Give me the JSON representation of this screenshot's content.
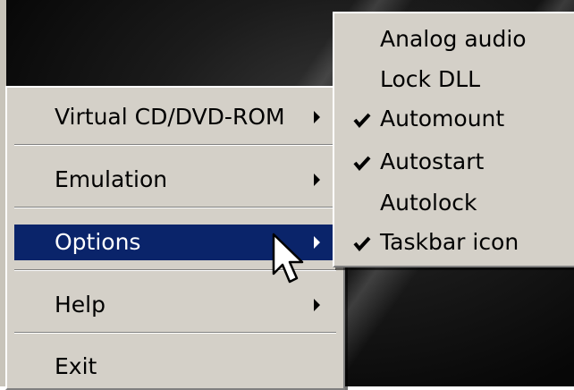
{
  "main_menu": {
    "items": [
      {
        "label": "Virtual CD/DVD-ROM",
        "has_submenu": true
      },
      {
        "label": "Emulation",
        "has_submenu": true
      },
      {
        "label": "Options",
        "has_submenu": true,
        "selected": true
      },
      {
        "label": "Help",
        "has_submenu": true
      },
      {
        "label": "Exit",
        "has_submenu": false
      }
    ]
  },
  "options_submenu": {
    "items": [
      {
        "label": "Analog audio",
        "checked": false
      },
      {
        "label": "Lock DLL",
        "checked": false
      },
      {
        "label": "Automount",
        "checked": true
      },
      {
        "label": "Autostart",
        "checked": true
      },
      {
        "label": "Autolock",
        "checked": false
      },
      {
        "label": "Taskbar icon",
        "checked": true
      }
    ]
  },
  "colors": {
    "menu_background": "#d4d0c8",
    "selection_highlight": "#0a246a",
    "selection_text": "#ffffff"
  }
}
